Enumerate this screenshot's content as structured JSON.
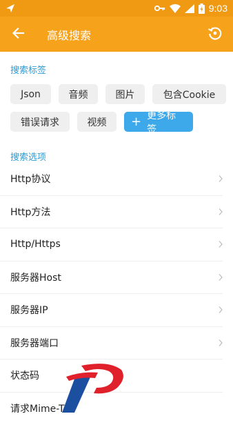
{
  "status_bar": {
    "time": "9:03"
  },
  "app_bar": {
    "title": "高级搜索"
  },
  "sections": {
    "tags_title": "搜索标签",
    "options_title": "搜索选项"
  },
  "tags": {
    "row1": [
      "Json",
      "音频",
      "图片",
      "包含Cookie"
    ],
    "row2": [
      "错误请求",
      "视频"
    ],
    "more": "更多标签"
  },
  "options": [
    "Http协议",
    "Http方法",
    "Http/Https",
    "服务器Host",
    "服务器IP",
    "服务器端口",
    "状态码",
    "请求Mime-T"
  ],
  "colors": {
    "accent": "#f7a21b",
    "status": "#ef9a12",
    "section": "#2f9bd4",
    "primary_chip": "#3ea9ea"
  }
}
